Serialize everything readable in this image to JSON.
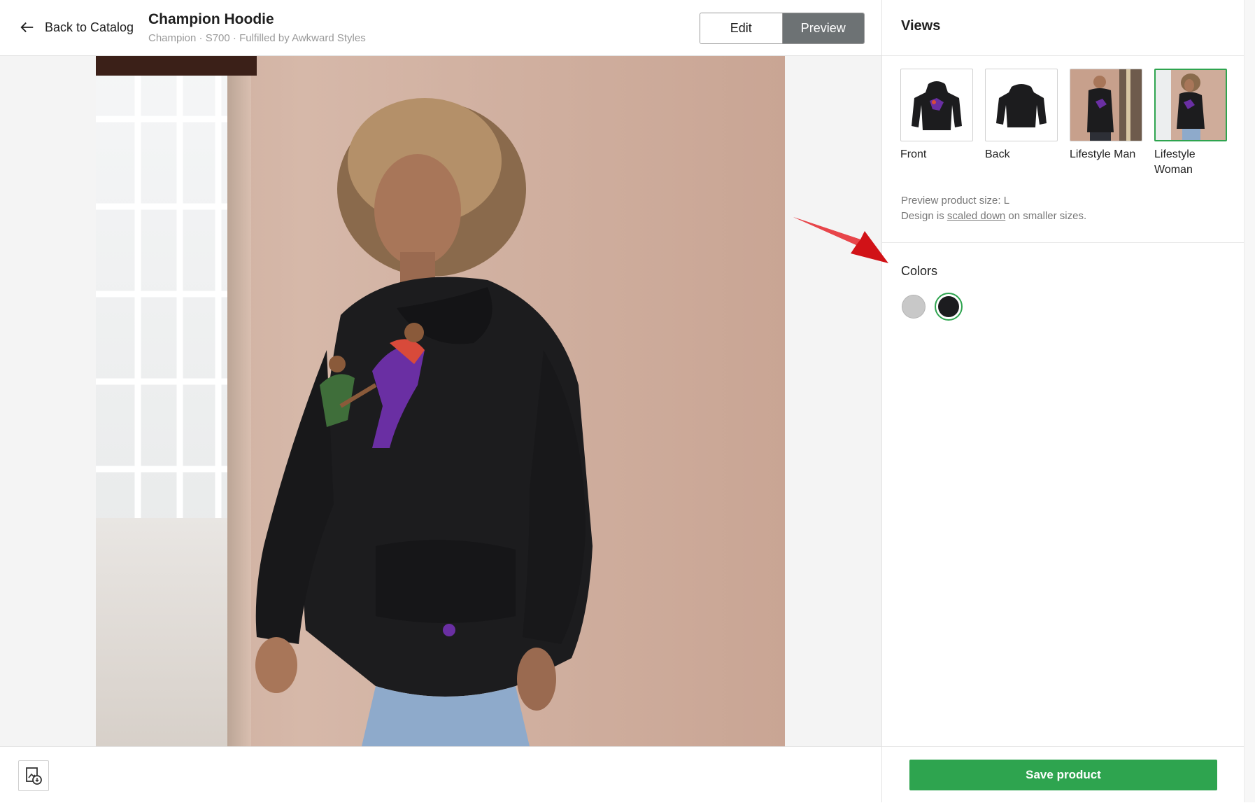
{
  "header": {
    "back_label": "Back to Catalog",
    "title": "Champion Hoodie",
    "subtitle": "Champion · S700 · Fulfilled by Awkward Styles",
    "mode_edit": "Edit",
    "mode_preview": "Preview",
    "active_mode": "Preview"
  },
  "panel": {
    "views_title": "Views",
    "views": [
      {
        "label": "Front",
        "active": false
      },
      {
        "label": "Back",
        "active": false
      },
      {
        "label": "Lifestyle Man",
        "active": false
      },
      {
        "label": "Lifestyle\nWoman",
        "active": true
      }
    ],
    "note_line1": "Preview product size: L",
    "note_prefix": "Design is ",
    "note_link": "scaled down",
    "note_suffix": " on smaller sizes.",
    "colors_title": "Colors",
    "colors": [
      {
        "hex": "#c8c8c8",
        "selected": false
      },
      {
        "hex": "#1c1c1f",
        "selected": true
      }
    ],
    "save_label": "Save product"
  },
  "colors": {
    "accent": "#2ea44f",
    "segment_active": "#6d7274",
    "annotation_arrow": "#d11217"
  }
}
